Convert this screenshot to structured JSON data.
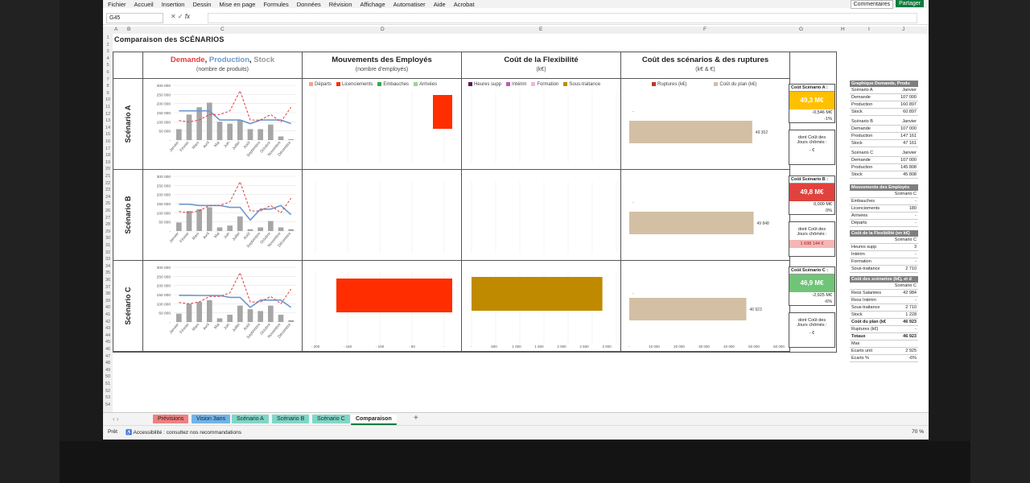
{
  "menu": [
    "Fichier",
    "Accueil",
    "Insertion",
    "Dessin",
    "Mise en page",
    "Formules",
    "Données",
    "Révision",
    "Affichage",
    "Automatiser",
    "Aide",
    "Acrobat"
  ],
  "top_buttons": {
    "comments": "Commentaires",
    "share": "Partager"
  },
  "formula_bar": {
    "namebox": "G45",
    "fx": "fx"
  },
  "columns": [
    "A",
    "B",
    "C",
    "D",
    "E",
    "F",
    "G",
    "H",
    "I",
    "J"
  ],
  "sheet_title": "Comparaison des SCÉNARIOS",
  "headers": {
    "demande": "Demande",
    "production": "Production",
    "stock": "Stock",
    "col1_sub": "(nombre de produits)",
    "col2_title": "Mouvements des Employés",
    "col2_sub": "(nombre d'employés)",
    "col3_title": "Coût de la Flexibilité",
    "col3_sub": "(k€)",
    "col4_title": "Coût des scénarios & des ruptures",
    "col4_sub": "(k€  &  €)"
  },
  "legends": {
    "employees": [
      "Départs",
      "Licenciements",
      "Embauches",
      "Arrivées"
    ],
    "flex": [
      "Heures supp",
      "Intérim",
      "Formation",
      "Sous-traitance"
    ],
    "cost": [
      "Ruptures (k€)",
      "Coût du plan (k€)"
    ]
  },
  "colors": {
    "red": "#ff2d00",
    "gold": "#c08a00",
    "tan": "#d2bfa4",
    "green_kpi": "#70c477",
    "yellow_kpi": "#ffc000",
    "red_kpi": "#e0423e",
    "bar_gray": "#a6a6a6",
    "line_blue": "#6d97cf",
    "line_red": "#e43b3b"
  },
  "scenarios": [
    {
      "label": "Scénario A",
      "kpi_title": "Coût Scénario A :",
      "kpi_value": "49,3 M€",
      "kpi_delta": "-0,546 M€",
      "kpi_pct": "-1%",
      "jours_label": "dont Coût des Jours chômés :",
      "jours_value": "-  €",
      "cost_value": "49 302",
      "kpi_color": "yellow"
    },
    {
      "label": "Scénario B",
      "kpi_title": "Coût Scénario B :",
      "kpi_value": "49,8 M€",
      "kpi_delta": "0,000 M€",
      "kpi_pct": "0%",
      "jours_label": "dont Coût des Jours chômés :",
      "jours_value": "1 698 144 €",
      "cost_value": "49 848",
      "kpi_color": "red"
    },
    {
      "label": "Scénario C",
      "kpi_title": "Coût Scénario C :",
      "kpi_value": "46,9 M€",
      "kpi_delta": "-2,925 M€",
      "kpi_pct": "-6%",
      "jours_label": "dont Coût des Jours chômés :",
      "jours_value": "-  €",
      "cost_value": "46 923",
      "kpi_color": "green"
    }
  ],
  "months": [
    "Janvier",
    "Février",
    "Mars",
    "Avril",
    "Mai",
    "Juin",
    "Juillet",
    "Août",
    "Septembre",
    "Octobre",
    "Novembre",
    "Décembre"
  ],
  "yticks": [
    "300 000",
    "250 000",
    "200 000",
    "150 000",
    "100 000",
    "50 000",
    "-"
  ],
  "emp_axis": [
    "- 200",
    "- 150",
    "- 100",
    "- 50",
    "-"
  ],
  "flex_axis": [
    "-",
    "500",
    "1 000",
    "1 500",
    "2 000",
    "2 500",
    "3 000"
  ],
  "cost_axis": [
    "-",
    "10 000",
    "20 000",
    "30 000",
    "40 000",
    "50 000",
    "60 000"
  ],
  "side": {
    "graph_title": "Graphique Demande, Produ",
    "blocks": [
      {
        "head": [
          "Scénario A",
          "Janvier"
        ],
        "rows": [
          [
            "Demande",
            "107 000"
          ],
          [
            "Production",
            "160 897"
          ],
          [
            "Stock",
            "60 897"
          ]
        ]
      },
      {
        "head": [
          "Scénario B",
          "Janvier"
        ],
        "rows": [
          [
            "Demande",
            "107 000"
          ],
          [
            "Production",
            "147 161"
          ],
          [
            "Stock",
            "47 161"
          ]
        ]
      },
      {
        "head": [
          "Scénario C",
          "Janvier"
        ],
        "rows": [
          [
            "Demande",
            "107 000"
          ],
          [
            "Production",
            "145 808"
          ],
          [
            "Stock",
            "45 808"
          ]
        ]
      }
    ],
    "emp_title": "Mouvements des Employés",
    "emp_head": "Scénario C",
    "emp_rows": [
      [
        "Embauches",
        "-"
      ],
      [
        "Licenciements",
        "180"
      ],
      [
        "Arrivées",
        "-"
      ],
      [
        "Départs",
        "-"
      ]
    ],
    "flex_title": "Coût de la Flexibilité (en k€)",
    "flex_head": "Scénario C",
    "flex_rows": [
      [
        "Heures supp",
        "3"
      ],
      [
        "Intérim",
        "-"
      ],
      [
        "Formation",
        "-"
      ],
      [
        "Sous-traitance",
        "2 710"
      ]
    ],
    "cost_title": "Coût des scénarios (k€), et d",
    "cost_head": "Scénario C",
    "cost_rows": [
      [
        "Ress Salariées",
        "42 984"
      ],
      [
        "Ress Intérim",
        "-"
      ],
      [
        "Sous-traitance",
        "2 710"
      ],
      [
        "Stock",
        "1 228"
      ],
      [
        "Coût du plan (k€",
        "46 923"
      ],
      [
        "Ruptures (k€)",
        "-"
      ],
      [
        "Totaux",
        "46 923"
      ],
      [
        "Max",
        ""
      ],
      [
        "Ecarts unit",
        "2 925"
      ],
      [
        "Ecarts %",
        "-6%"
      ]
    ]
  },
  "tabs": [
    "Prévisions",
    "Vision 3ans",
    "Scénario A",
    "Scénario B",
    "Scénario C",
    "Comparaison"
  ],
  "status": {
    "ready": "Prêt",
    "accessibility": "Accessibilité : consultez nos recommandations",
    "zoom": "70 %"
  },
  "chart_data": [
    {
      "type": "bar",
      "title": "Scénario A",
      "categories": [
        "Janvier",
        "Février",
        "Mars",
        "Avril",
        "Mai",
        "Juin",
        "Juillet",
        "Août",
        "Septembre",
        "Octobre",
        "Novembre",
        "Décembre"
      ],
      "series": [
        {
          "name": "Stock",
          "values": [
            60000,
            140000,
            180000,
            205000,
            100000,
            90000,
            110000,
            60000,
            60000,
            85000,
            20000,
            5000
          ]
        },
        {
          "name": "Production",
          "values": [
            160000,
            160000,
            160000,
            160000,
            110000,
            110000,
            110000,
            90000,
            110000,
            110000,
            110000,
            90000
          ]
        },
        {
          "name": "Demande",
          "values": [
            107000,
            100000,
            110000,
            140000,
            140000,
            160000,
            270000,
            110000,
            110000,
            140000,
            100000,
            180000
          ]
        }
      ],
      "ylim": [
        0,
        300000
      ]
    },
    {
      "type": "bar",
      "title": "Scénario B",
      "categories": [
        "Janvier",
        "Février",
        "Mars",
        "Avril",
        "Mai",
        "Juin",
        "Juillet",
        "Août",
        "Septembre",
        "Octobre",
        "Novembre",
        "Décembre"
      ],
      "series": [
        {
          "name": "Stock",
          "values": [
            47000,
            110000,
            120000,
            130000,
            20000,
            30000,
            80000,
            10000,
            20000,
            55000,
            20000,
            10000
          ]
        },
        {
          "name": "Production",
          "values": [
            147000,
            147000,
            140000,
            140000,
            140000,
            130000,
            130000,
            60000,
            120000,
            120000,
            140000,
            90000
          ]
        },
        {
          "name": "Demande",
          "values": [
            107000,
            100000,
            110000,
            140000,
            140000,
            160000,
            270000,
            110000,
            110000,
            140000,
            100000,
            180000
          ]
        }
      ],
      "ylim": [
        0,
        300000
      ]
    },
    {
      "type": "bar",
      "title": "Scénario C",
      "categories": [
        "Janvier",
        "Février",
        "Mars",
        "Avril",
        "Mai",
        "Juin",
        "Juillet",
        "Août",
        "Septembre",
        "Octobre",
        "Novembre",
        "Décembre"
      ],
      "series": [
        {
          "name": "Stock",
          "values": [
            45800,
            100000,
            110000,
            120000,
            20000,
            40000,
            90000,
            70000,
            60000,
            90000,
            40000,
            10000
          ]
        },
        {
          "name": "Production",
          "values": [
            145800,
            145800,
            145000,
            145000,
            145000,
            135000,
            135000,
            80000,
            120000,
            120000,
            120000,
            80000
          ]
        },
        {
          "name": "Demande",
          "values": [
            107000,
            100000,
            110000,
            140000,
            140000,
            160000,
            270000,
            110000,
            110000,
            140000,
            100000,
            180000
          ]
        }
      ],
      "ylim": [
        0,
        300000
      ]
    },
    {
      "type": "bar",
      "title": "Mouvements des Employés",
      "rows": [
        "Scénario A",
        "Scénario B",
        "Scénario C"
      ],
      "series": [
        {
          "name": "Licenciements",
          "values": [
            -30,
            0,
            -180
          ]
        }
      ],
      "xlim": [
        -200,
        0
      ]
    },
    {
      "type": "bar",
      "title": "Coût de la Flexibilité",
      "rows": [
        "Scénario A",
        "Scénario B",
        "Scénario C"
      ],
      "series": [
        {
          "name": "Sous-traitance",
          "values": [
            0,
            0,
            2710
          ]
        }
      ],
      "xlim": [
        0,
        3000
      ]
    },
    {
      "type": "bar",
      "title": "Coût des scénarios & des ruptures",
      "rows": [
        "Scénario A",
        "Scénario B",
        "Scénario C"
      ],
      "series": [
        {
          "name": "Coût du plan (k€)",
          "values": [
            49302,
            49848,
            46923
          ]
        }
      ],
      "xlim": [
        0,
        60000
      ]
    }
  ]
}
